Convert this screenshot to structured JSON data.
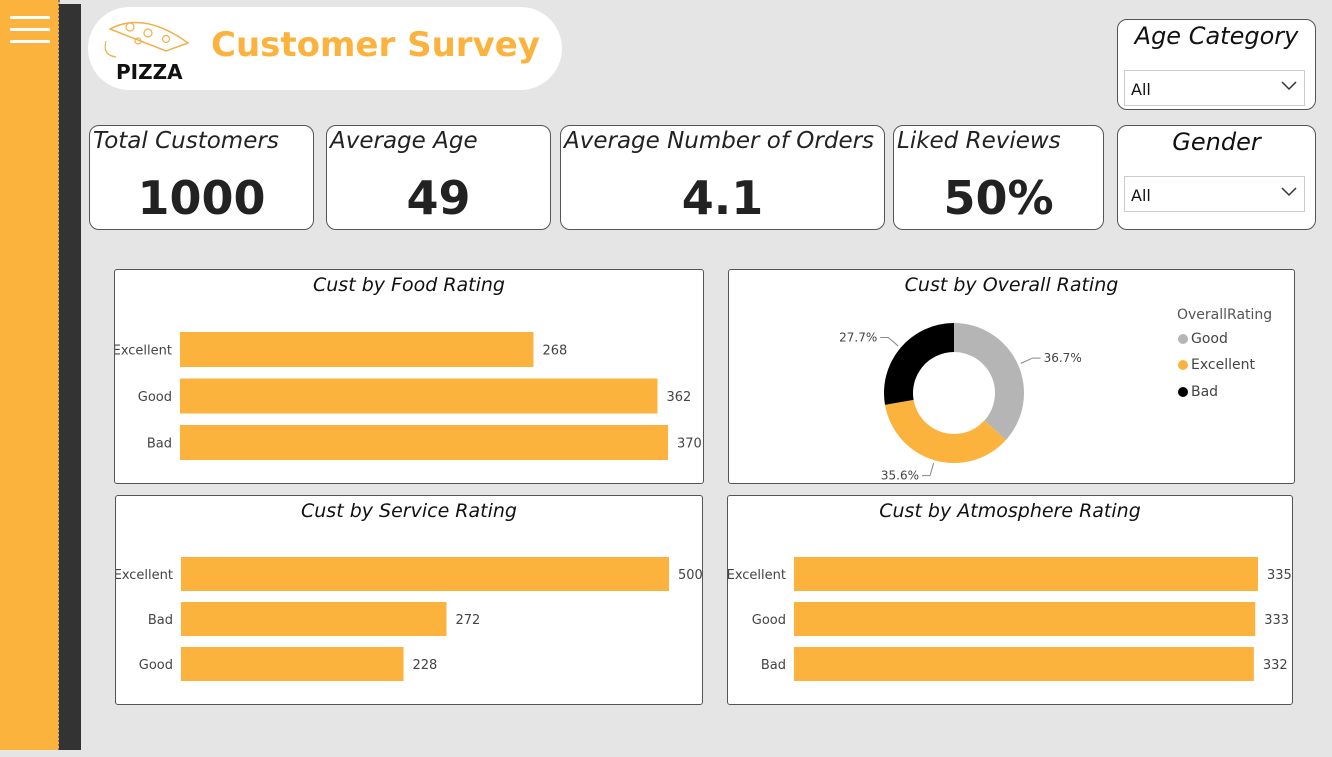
{
  "header": {
    "title": "Customer Survey",
    "logo_text": "PIZZA"
  },
  "kpis": [
    {
      "label": "Total Customers",
      "value": "1000"
    },
    {
      "label": "Average Age",
      "value": "49"
    },
    {
      "label": "Average Number of Orders",
      "value": "4.1"
    },
    {
      "label": "Liked Reviews",
      "value": "50%"
    }
  ],
  "slicers": {
    "age": {
      "title": "Age Category",
      "value": "All"
    },
    "gender": {
      "title": "Gender",
      "value": "All"
    }
  },
  "colors": {
    "accent": "#fcb33e",
    "dark": "#333333",
    "good": "#b5b5b5",
    "excellent": "#fcb33e",
    "bad": "#000000"
  },
  "chart_data": [
    {
      "type": "bar",
      "orientation": "horizontal",
      "title": "Cust by Food Rating",
      "categories": [
        "Excellent",
        "Good",
        "Bad"
      ],
      "values": [
        268,
        362,
        370
      ],
      "color": "#fcb33e"
    },
    {
      "type": "pie",
      "variant": "donut",
      "title": "Cust by Overall Rating",
      "legend_title": "OverallRating",
      "categories": [
        "Good",
        "Excellent",
        "Bad"
      ],
      "values": [
        36.7,
        35.6,
        27.7
      ],
      "labels": [
        "36.7%",
        "35.6%",
        "27.7%"
      ],
      "colors": [
        "#b5b5b5",
        "#fcb33e",
        "#000000"
      ],
      "legend_position": "right"
    },
    {
      "type": "bar",
      "orientation": "horizontal",
      "title": "Cust by Service Rating",
      "categories": [
        "Excellent",
        "Bad",
        "Good"
      ],
      "values": [
        500,
        272,
        228
      ],
      "color": "#fcb33e"
    },
    {
      "type": "bar",
      "orientation": "horizontal",
      "title": "Cust by Atmosphere Rating",
      "categories": [
        "Excellent",
        "Good",
        "Bad"
      ],
      "values": [
        335,
        333,
        332
      ],
      "color": "#fcb33e"
    }
  ]
}
